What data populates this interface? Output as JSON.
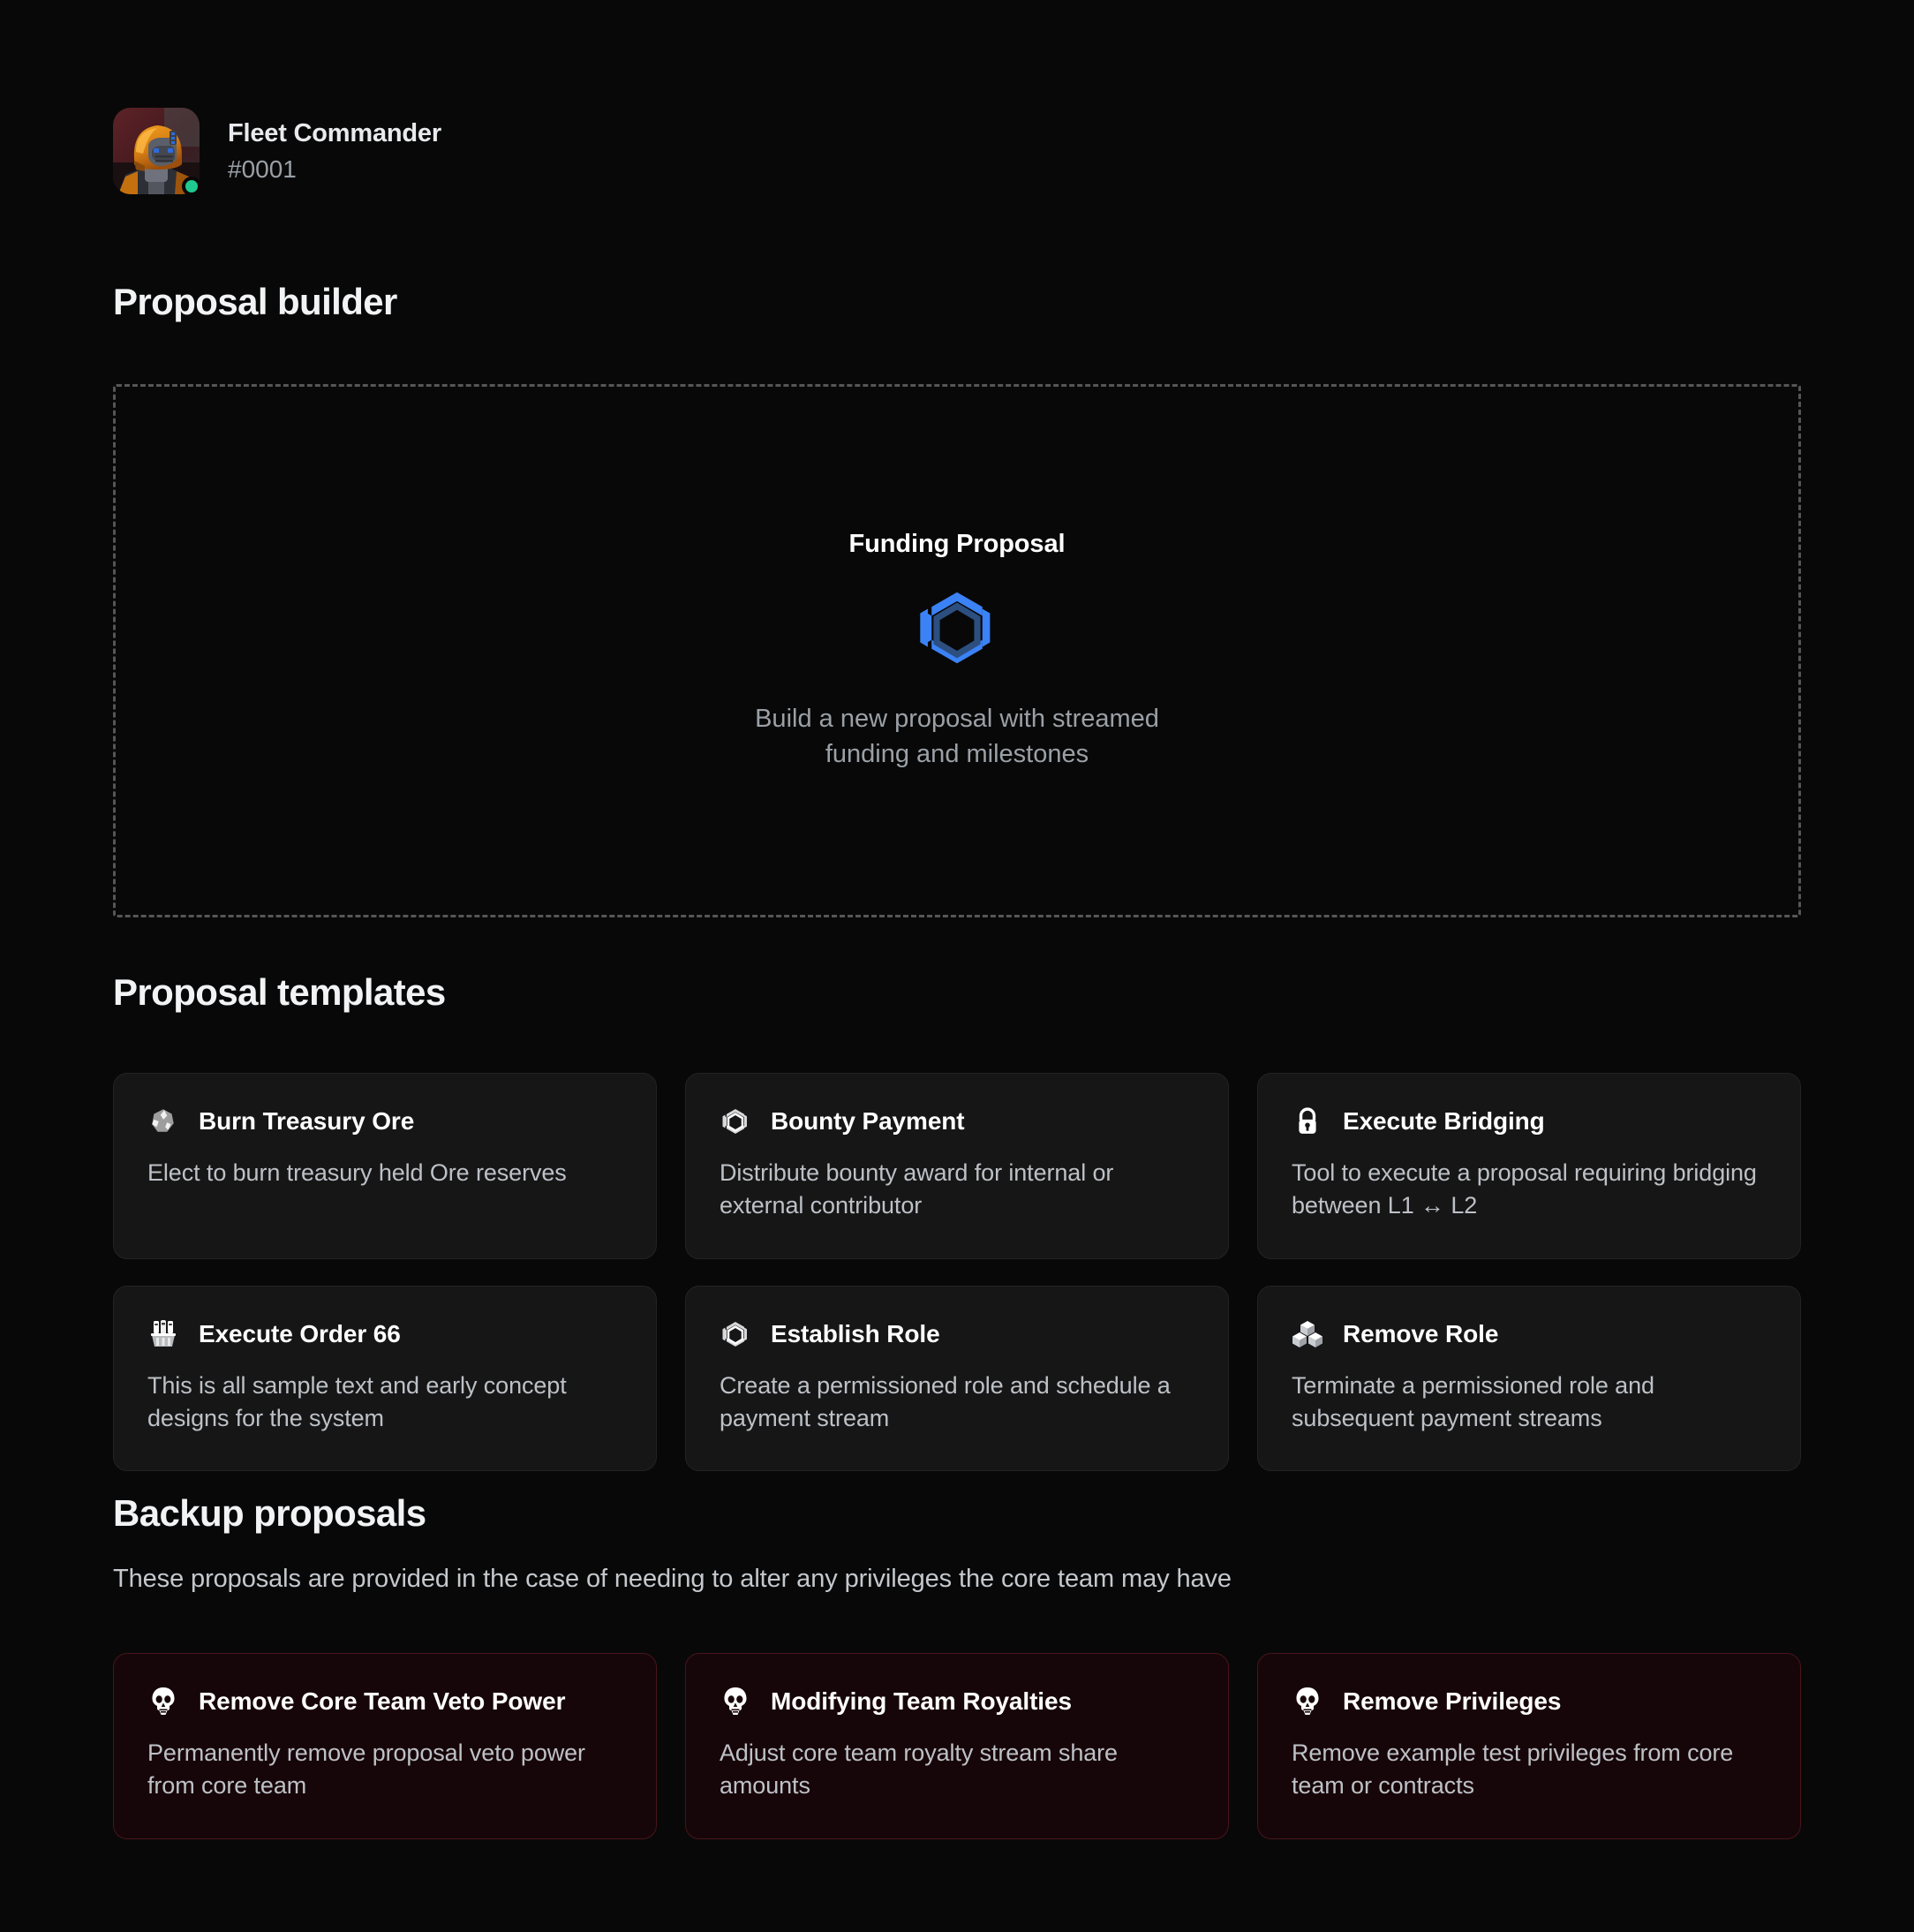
{
  "profile": {
    "name": "Fleet Commander",
    "id": "#0001",
    "status": "online",
    "status_color": "#1fc98f",
    "avatar_alt": "fleet-commander-avatar"
  },
  "builder": {
    "heading": "Proposal builder",
    "dropzone": {
      "title": "Funding Proposal",
      "icon": "hexagon-icon",
      "icon_color": "#3b82f6",
      "description": "Build a new proposal with streamed funding and milestones"
    }
  },
  "templates": {
    "heading": "Proposal templates",
    "cards": [
      {
        "icon": "ore-icon",
        "title": "Burn Treasury Ore",
        "description": "Elect to burn treasury held Ore reserves"
      },
      {
        "icon": "hexagon-icon",
        "title": "Bounty Payment",
        "description": "Distribute bounty award for internal or external contributor"
      },
      {
        "icon": "lock-icon",
        "title": "Execute Bridging",
        "description": "Tool to execute a proposal requiring bridging between L1 ↔ L2"
      },
      {
        "icon": "troops-icon",
        "title": "Execute Order 66",
        "description": "This is all sample text and early concept designs for the system"
      },
      {
        "icon": "hexagon-icon",
        "title": "Establish Role",
        "description": "Create a permissioned role and schedule a payment stream"
      },
      {
        "icon": "cubes-icon",
        "title": "Remove Role",
        "description": "Terminate a permissioned role and subsequent payment streams"
      }
    ]
  },
  "backup": {
    "heading": "Backup proposals",
    "subheading": "These proposals are provided in the case of needing to alter any privileges the core team may have",
    "accent_color": "#47151c",
    "cards": [
      {
        "icon": "skull-icon",
        "title": "Remove Core Team Veto Power",
        "description": "Permanently remove proposal veto power from core team"
      },
      {
        "icon": "skull-icon",
        "title": "Modifying Team Royalties",
        "description": "Adjust core team royalty stream share amounts"
      },
      {
        "icon": "skull-icon",
        "title": "Remove Privileges",
        "description": "Remove example test privileges from core team or contracts"
      }
    ]
  }
}
